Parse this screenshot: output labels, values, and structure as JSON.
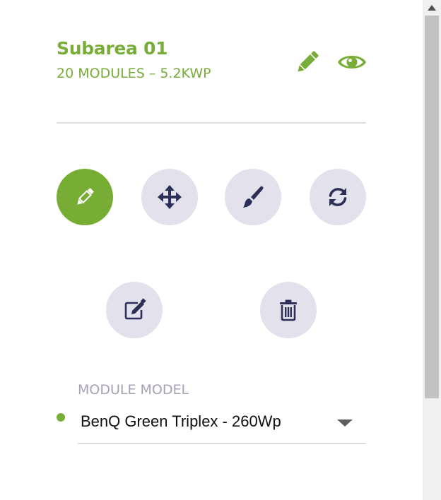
{
  "subarea": {
    "title": "Subarea 01",
    "summary": "20 MODULES – 5.2KWP"
  },
  "header_icons": [
    "pencil-icon",
    "eye-icon"
  ],
  "tools": [
    {
      "name": "draw",
      "icon": "pencil-icon",
      "active": true
    },
    {
      "name": "move",
      "icon": "arrows-move-icon",
      "active": false
    },
    {
      "name": "paint",
      "icon": "paint-brush-icon",
      "active": false
    },
    {
      "name": "rotate",
      "icon": "refresh-icon",
      "active": false
    },
    {
      "name": "edit",
      "icon": "edit-square-icon",
      "active": false
    },
    {
      "name": "delete",
      "icon": "trash-icon",
      "active": false
    }
  ],
  "module_model": {
    "label": "MODULE MODEL",
    "value": "BenQ Green Triplex - 260Wp",
    "status_color": "#79ad3a"
  },
  "colors": {
    "accent": "#79ad3a",
    "button_bg": "#e2e1ec",
    "icon_dark": "#2c2f57",
    "muted_text": "#a3a2b7"
  }
}
